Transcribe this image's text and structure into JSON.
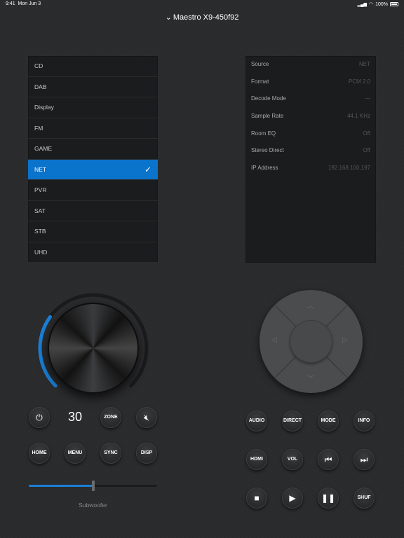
{
  "status": {
    "time": "9:41",
    "date": "Mon Jun 3",
    "signal": "▂▄▆",
    "wifi": "◠",
    "battery": "100%"
  },
  "title": "Maestro X9-450f92",
  "sources": [
    {
      "label": "CD",
      "selected": false
    },
    {
      "label": "DAB",
      "selected": false
    },
    {
      "label": "Display",
      "selected": false
    },
    {
      "label": "FM",
      "selected": false
    },
    {
      "label": "GAME",
      "selected": false
    },
    {
      "label": "NET",
      "selected": true
    },
    {
      "label": "PVR",
      "selected": false
    },
    {
      "label": "SAT",
      "selected": false
    },
    {
      "label": "STB",
      "selected": false
    },
    {
      "label": "UHD",
      "selected": false
    }
  ],
  "info": [
    {
      "label": "Source",
      "value": "NET"
    },
    {
      "label": "Format",
      "value": "PCM 2.0"
    },
    {
      "label": "Decode Mode",
      "value": "—"
    },
    {
      "label": "Sample Rate",
      "value": "44.1 KHz"
    },
    {
      "label": "Room EQ",
      "value": "Off"
    },
    {
      "label": "Stereo Direct",
      "value": "Off"
    },
    {
      "label": "IP Address",
      "value": "192.168.100.197"
    }
  ],
  "volume": {
    "value": "30",
    "level": 0.3
  },
  "buttons": {
    "zone": "ZONE",
    "home": "HOME",
    "menu": "MENU",
    "sync": "SYNC",
    "disp": "DISP",
    "audio": "AUDIO",
    "direct": "DIRECT",
    "mode": "MODE",
    "info": "INFO",
    "hdmi": "HDMI",
    "vol": "VOL",
    "shuf": "SHUF"
  },
  "subwoofer": {
    "label": "Subwoofer",
    "level": 0.5
  },
  "colors": {
    "accent": "#0a73cc",
    "background": "#2a2b2d"
  }
}
